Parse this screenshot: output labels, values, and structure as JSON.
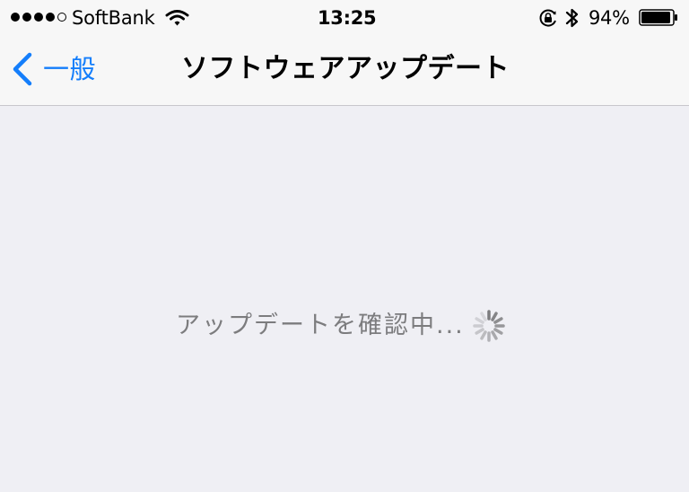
{
  "status_bar": {
    "signal_dots": [
      "filled",
      "filled",
      "filled",
      "filled",
      "empty"
    ],
    "carrier": "SoftBank",
    "wifi_icon": "wifi-icon",
    "time": "13:25",
    "orientation_lock_icon": "orientation-lock-icon",
    "bluetooth_icon": "bluetooth-icon",
    "battery_percent": "94%",
    "battery_level": 0.94,
    "battery_icon": "battery-icon"
  },
  "nav": {
    "back_icon": "chevron-left-icon",
    "back_label": "一般",
    "title": "ソフトウェアアップデート"
  },
  "main": {
    "status_text": "アップデートを確認中...",
    "spinner_icon": "spinner-icon"
  },
  "colors": {
    "accent": "#147efb",
    "bar_background": "#f7f7f7",
    "page_background": "#efeff4",
    "secondary_text": "#7c7c7e"
  }
}
